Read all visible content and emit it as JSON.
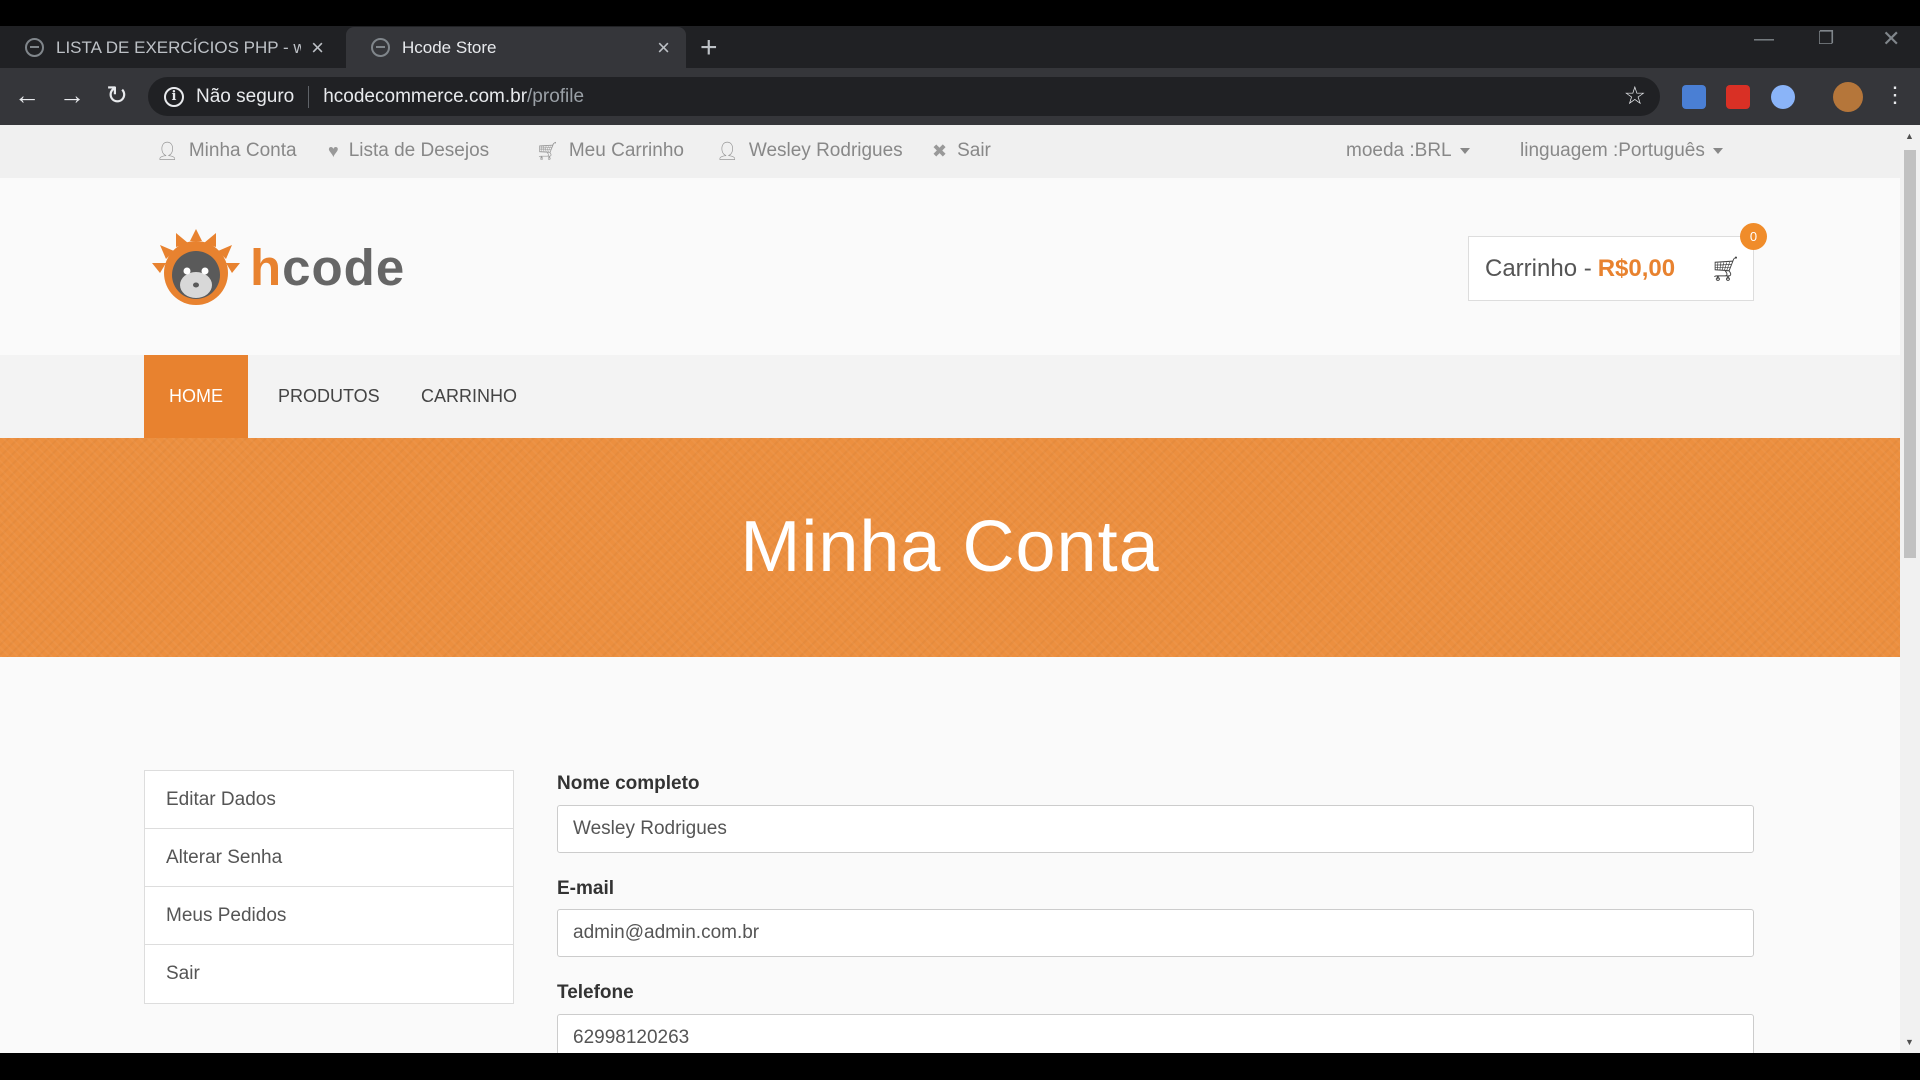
{
  "browser": {
    "tabs": [
      {
        "title": "LISTA DE EXERCÍCIOS PHP - www.",
        "active": false
      },
      {
        "title": "Hcode Store",
        "active": true
      }
    ],
    "new_tab": "+",
    "security_label": "Não seguro",
    "url_host": "hcodecommerce.com.br",
    "url_path": "/profile"
  },
  "userbar": {
    "items": [
      {
        "label": "Minha Conta",
        "icon": "user-icon"
      },
      {
        "label": "Lista de Desejos",
        "icon": "heart-icon"
      },
      {
        "label": "Meu Carrinho",
        "icon": "cart-icon"
      },
      {
        "label": "Wesley Rodrigues",
        "icon": "user-icon"
      },
      {
        "label": "Sair",
        "icon": "close-icon"
      }
    ],
    "currency": "moeda :BRL",
    "language": "linguagem :Português"
  },
  "header": {
    "logo_text": "hcode",
    "cart_label": "Carrinho -",
    "cart_total": "R$0,00",
    "cart_count": "0"
  },
  "nav": {
    "items": [
      {
        "label": "HOME",
        "active": true
      },
      {
        "label": "PRODUTOS",
        "active": false
      },
      {
        "label": "CARRINHO",
        "active": false
      }
    ]
  },
  "banner": {
    "title": "Minha Conta"
  },
  "sidebar": {
    "items": [
      {
        "label": "Editar Dados"
      },
      {
        "label": "Alterar Senha"
      },
      {
        "label": "Meus Pedidos"
      },
      {
        "label": "Sair"
      }
    ]
  },
  "form": {
    "name_label": "Nome completo",
    "name_value": "Wesley Rodrigues",
    "email_label": "E-mail",
    "email_value": "admin@admin.com.br",
    "phone_label": "Telefone",
    "phone_value": "62998120263"
  },
  "colors": {
    "accent": "#e8822f",
    "banner": "#ec8f3f",
    "chrome": "#202124"
  }
}
